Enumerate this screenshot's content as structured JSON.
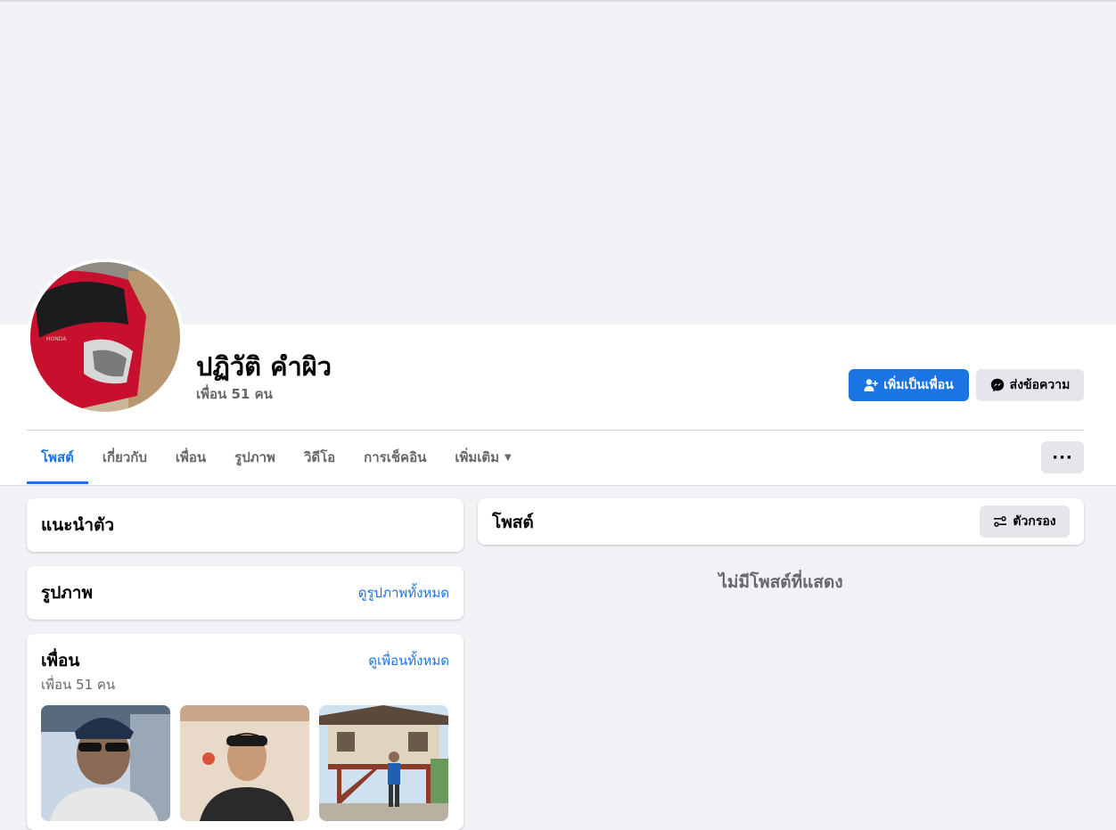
{
  "profile": {
    "name": "ปฏิวัติ คำผิว",
    "friend_count_label": "เพื่อน 51 คน"
  },
  "actions": {
    "add_friend_label": "เพิ่มเป็นเพื่อน",
    "message_label": "ส่งข้อความ",
    "more_label": "···"
  },
  "tabs": [
    {
      "label": "โพสต์",
      "active": true
    },
    {
      "label": "เกี่ยวกับ"
    },
    {
      "label": "เพื่อน"
    },
    {
      "label": "รูปภาพ"
    },
    {
      "label": "วิดีโอ"
    },
    {
      "label": "การเช็คอิน"
    },
    {
      "label": "เพิ่มเติม"
    }
  ],
  "intro": {
    "title": "แนะนำตัว"
  },
  "photos": {
    "title": "รูปภาพ",
    "see_all": "ดูรูปภาพทั้งหมด"
  },
  "friends": {
    "title": "เพื่อน",
    "see_all": "ดูเพื่อนทั้งหมด",
    "count_label": "เพื่อน 51 คน"
  },
  "posts": {
    "title": "โพสต์",
    "filter_label": "ตัวกรอง",
    "empty_message": "ไม่มีโพสต์ที่แสดง"
  },
  "colors": {
    "accent": "#1b74e4",
    "background": "#f0f2f5",
    "secondary_button": "#e4e6eb"
  }
}
